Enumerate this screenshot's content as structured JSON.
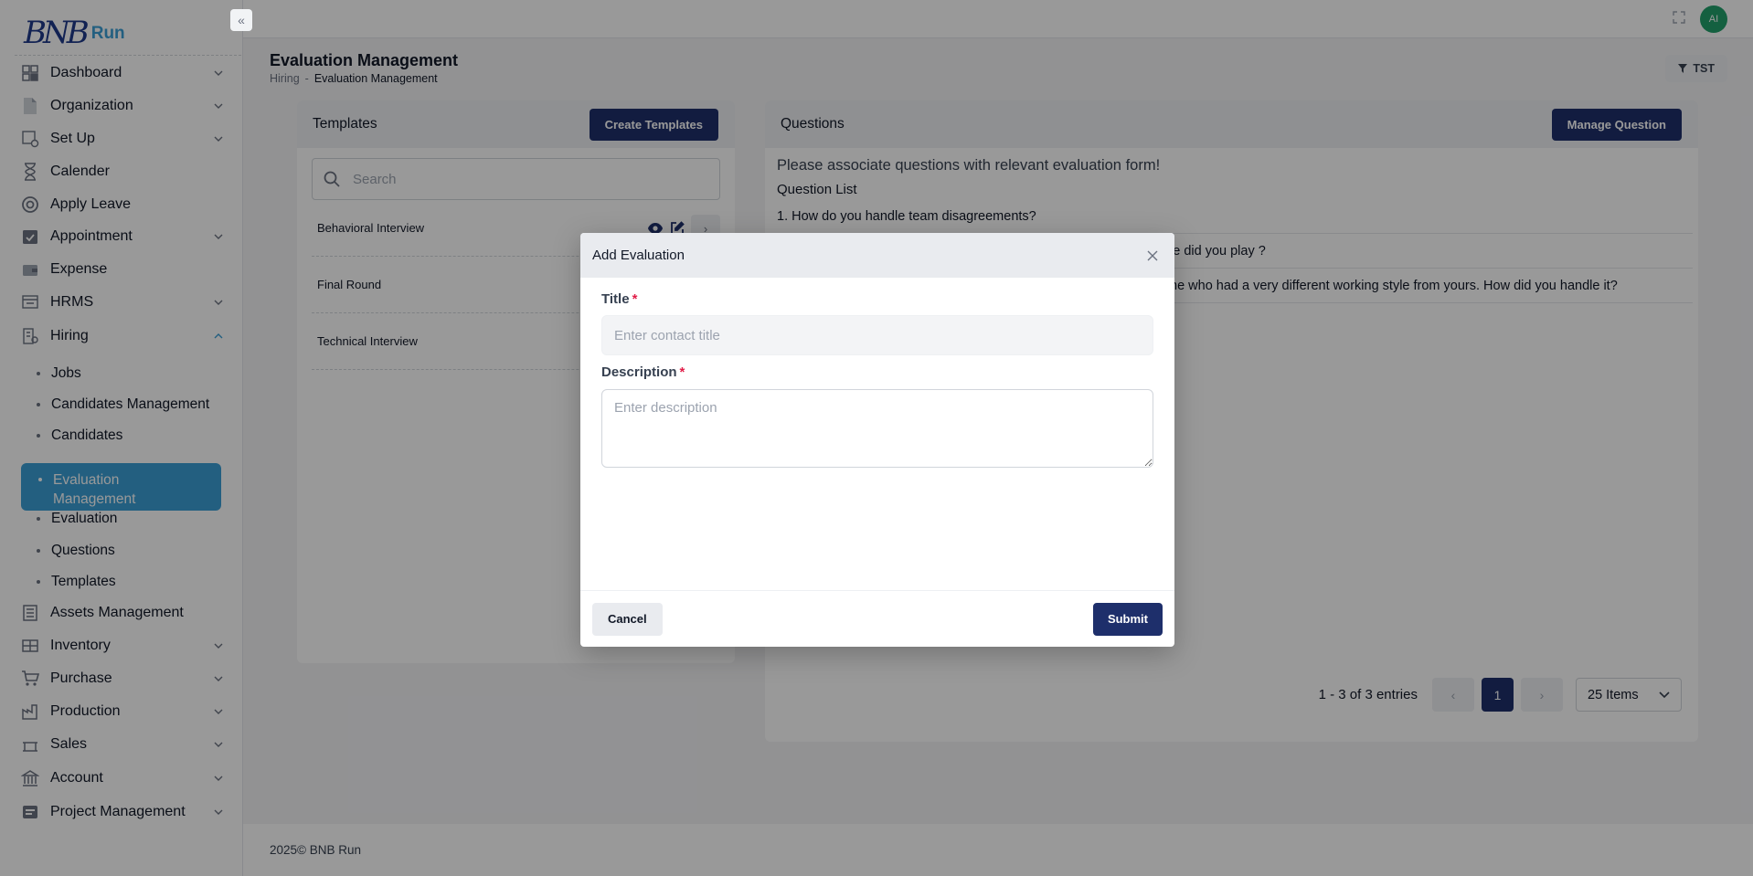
{
  "brand": {
    "logo_mark": "BNB",
    "logo_word": "Run"
  },
  "sidebar": {
    "items": [
      {
        "label": "Dashboard",
        "icon": "dashboard-icon",
        "has_children": true
      },
      {
        "label": "Organization",
        "icon": "document-icon",
        "has_children": true
      },
      {
        "label": "Set Up",
        "icon": "setup-icon",
        "has_children": true
      },
      {
        "label": "Calender",
        "icon": "hourglass-icon",
        "has_children": false
      },
      {
        "label": "Apply Leave",
        "icon": "lifebuoy-icon",
        "has_children": false
      },
      {
        "label": "Appointment",
        "icon": "calendar-check-icon",
        "has_children": true
      },
      {
        "label": "Expense",
        "icon": "wallet-icon",
        "has_children": false
      },
      {
        "label": "HRMS",
        "icon": "hrms-icon",
        "has_children": true
      },
      {
        "label": "Hiring",
        "icon": "hiring-icon",
        "has_children": true,
        "expanded": true
      },
      {
        "label": "Assets Management",
        "icon": "assets-icon",
        "has_children": false
      },
      {
        "label": "Inventory",
        "icon": "inventory-icon",
        "has_children": true
      },
      {
        "label": "Purchase",
        "icon": "cart-icon",
        "has_children": true
      },
      {
        "label": "Production",
        "icon": "factory-icon",
        "has_children": true
      },
      {
        "label": "Sales",
        "icon": "sales-icon",
        "has_children": true
      },
      {
        "label": "Account",
        "icon": "bank-icon",
        "has_children": true
      },
      {
        "label": "Project Management",
        "icon": "project-icon",
        "has_children": true
      }
    ],
    "hiring_children": [
      {
        "label": "Jobs"
      },
      {
        "label": "Candidates Management"
      },
      {
        "label": "Candidates"
      },
      {
        "label": "Evaluation Management",
        "active": true
      },
      {
        "label": "Evaluation"
      },
      {
        "label": "Questions"
      },
      {
        "label": "Templates"
      }
    ]
  },
  "topbar": {
    "avatar_initials": "AI",
    "expand_icon": "fullscreen-icon"
  },
  "page": {
    "title": "Evaluation Management",
    "breadcrumb": [
      "Hiring",
      "Evaluation Management"
    ],
    "breadcrumb_sep": "-",
    "filter_button": "TST"
  },
  "templates_card": {
    "title": "Templates",
    "create_button": "Create Templates",
    "search_placeholder": "Search",
    "rows": [
      {
        "name": "Behavioral Interview",
        "show_actions": true
      },
      {
        "name": "Final Round",
        "show_actions": false
      },
      {
        "name": "Technical Interview",
        "show_actions": false
      }
    ]
  },
  "questions_card": {
    "title": "Questions",
    "manage_button": "Manage Question",
    "notice": "Please associate questions with relevant evaluation form!",
    "list_title": "Question List",
    "rows": [
      "1. How do you handle team disagreements?",
      "le did you play ?",
      "ne who had a very different working style from yours. How did you handle it?"
    ],
    "pagination": {
      "info": "1 - 3 of 3 entries",
      "prev": "‹",
      "current": "1",
      "next": "›",
      "per_page": "25 Items"
    }
  },
  "footer": {
    "text": "2025© BNB Run"
  },
  "modal": {
    "title": "Add Evaluation",
    "title_label": "Title",
    "title_placeholder": "Enter contact title",
    "description_label": "Description",
    "description_placeholder": "Enter description",
    "required_mark": "*",
    "cancel_button": "Cancel",
    "submit_button": "Submit"
  },
  "colors": {
    "primary": "#1e2f6b",
    "accent": "#3b9fd6",
    "avatar": "#22a06b",
    "required": "#e11d48"
  }
}
